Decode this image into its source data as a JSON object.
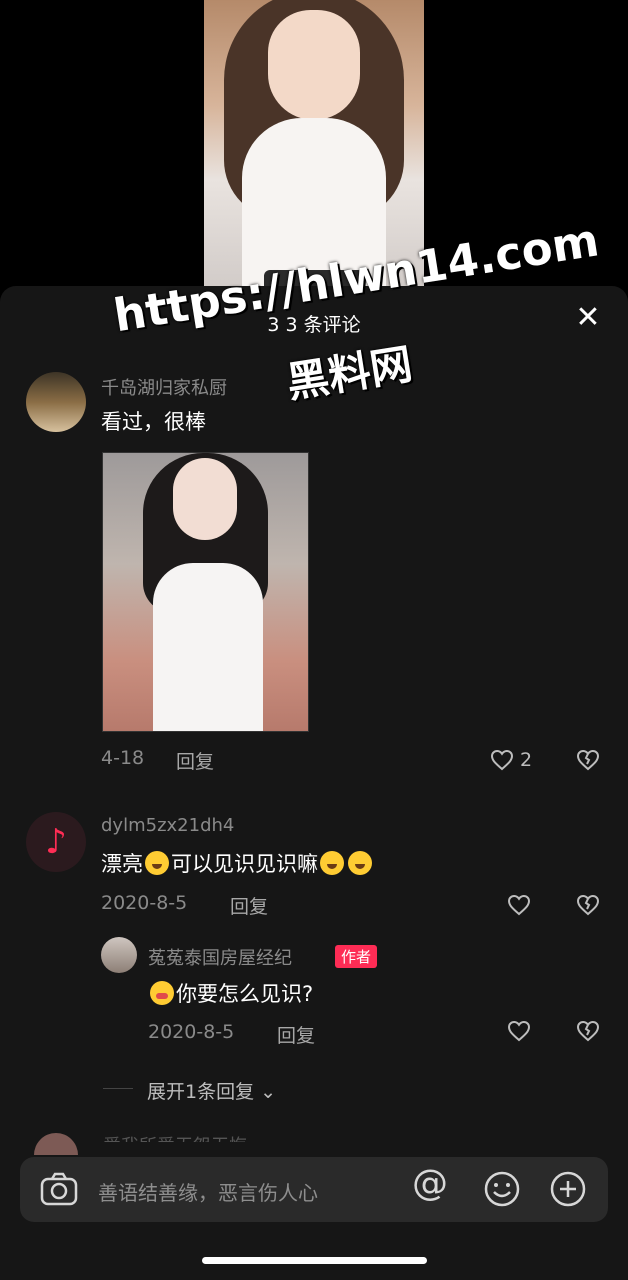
{
  "watermark": {
    "url": "https://hlwn14.com",
    "name": "黑料网"
  },
  "sheet": {
    "title": "3 3 条评论",
    "close_icon": "close-icon"
  },
  "comments": [
    {
      "username": "千岛湖归家私厨",
      "text": "看过，很棒",
      "date": "4-18",
      "reply_label": "回复",
      "likes": "2",
      "has_image": true
    },
    {
      "username": "dylm5zx21dh4",
      "text_parts": [
        "漂亮",
        "可以见识见识嘛"
      ],
      "date": "2020-8-5",
      "reply_label": "回复"
    }
  ],
  "reply": {
    "username": "菟菟泰国房屋经纪",
    "badge": "作者",
    "text": "你要怎么见识?",
    "date": "2020-8-5",
    "reply_label": "回复"
  },
  "expand_label": "展开1条回复",
  "next_comment_username": "爱我所爱无怨无悔",
  "input": {
    "placeholder": "善语结善缘，恶言伤人心",
    "at_symbol": "@"
  },
  "colors": {
    "sheet_bg": "#161616",
    "accent": "#fe2c55",
    "muted_text": "#8a8a8a",
    "input_bg": "#2a2a2a"
  }
}
